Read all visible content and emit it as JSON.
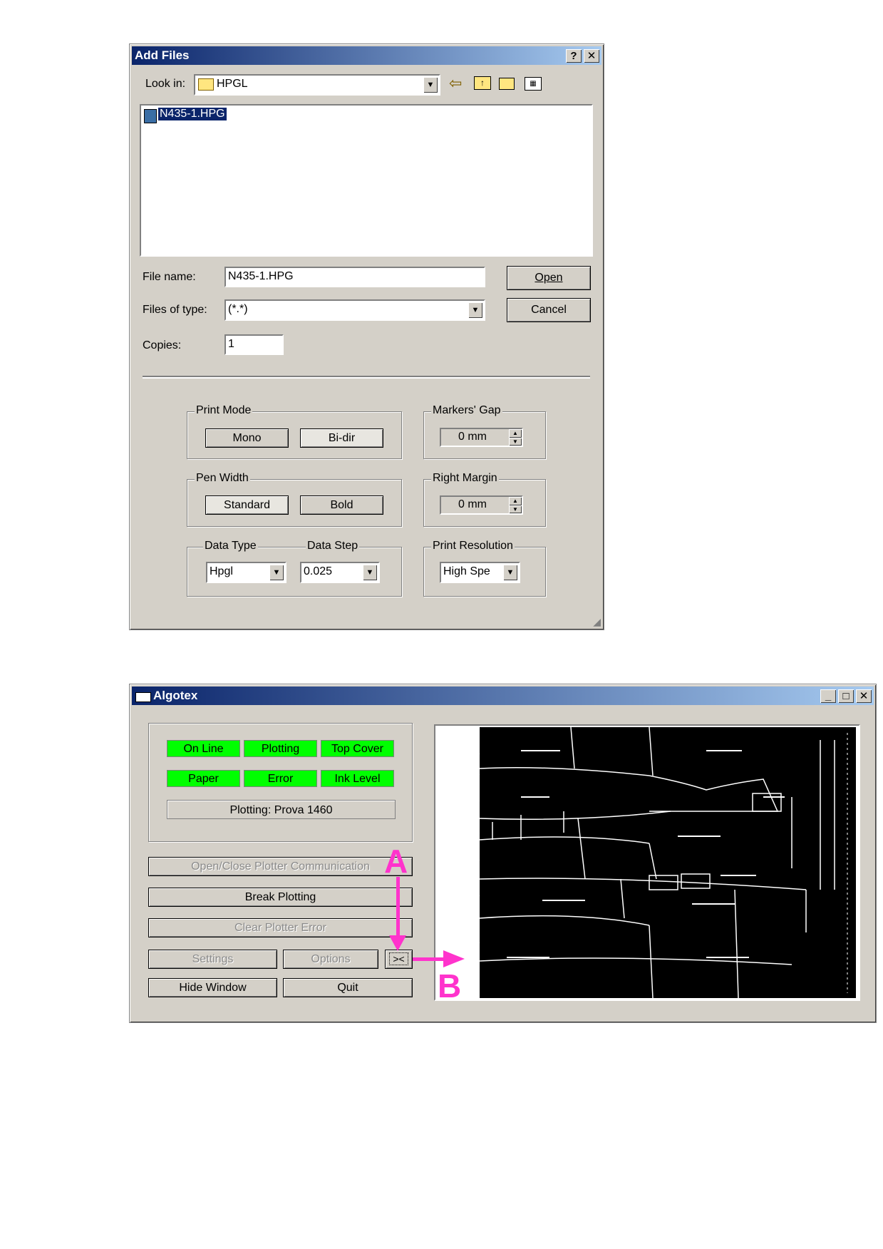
{
  "add_files": {
    "title": "Add Files",
    "help_btn": "?",
    "close_btn": "✕",
    "look_in_label": "Look in:",
    "look_in_value": "HPGL",
    "files": [
      "N435-1.HPG"
    ],
    "file_name_label": "File name:",
    "file_name_value": "N435-1.HPG",
    "files_of_type_label": "Files of type:",
    "files_of_type_value": "(*.*)",
    "copies_label": "Copies:",
    "copies_value": "1",
    "open_btn": "Open",
    "cancel_btn": "Cancel",
    "print_mode": {
      "label": "Print Mode",
      "mono": "Mono",
      "bidir": "Bi-dir"
    },
    "markers_gap": {
      "label": "Markers' Gap",
      "value": "0 mm"
    },
    "pen_width": {
      "label": "Pen Width",
      "standard": "Standard",
      "bold": "Bold"
    },
    "right_margin": {
      "label": "Right Margin",
      "value": "0 mm"
    },
    "data_type": {
      "label": "Data Type",
      "value": "Hpgl"
    },
    "data_step": {
      "label": "Data Step",
      "value": "0.025"
    },
    "print_resolution": {
      "label": "Print Resolution",
      "value": "High Spe"
    }
  },
  "algotex": {
    "title": "Algotex",
    "status": {
      "on_line": "On Line",
      "plotting": "Plotting",
      "top_cover": "Top Cover",
      "paper": "Paper",
      "error": "Error",
      "ink_level": "Ink Level"
    },
    "plotting_text": "Plotting: Prova 1460",
    "open_close_btn": "Open/Close Plotter Communication",
    "break_btn": "Break Plotting",
    "clear_btn": "Clear Plotter Error",
    "settings_btn": "Settings",
    "options_btn": "Options",
    "toggle_btn": "><",
    "hide_btn": "Hide Window",
    "quit_btn": "Quit",
    "annotation_a": "A",
    "annotation_b": "B",
    "status_color": "#00ff00"
  }
}
